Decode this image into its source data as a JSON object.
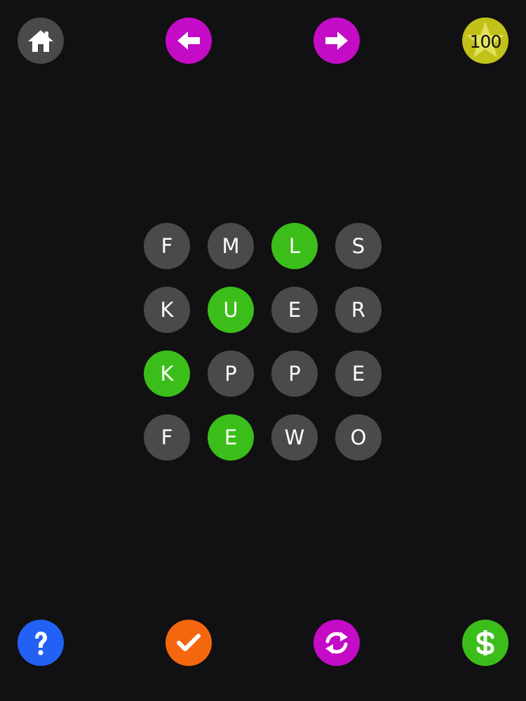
{
  "top_bar": {
    "home": {
      "icon": "home-icon"
    },
    "prev": {
      "icon": "arrow-left-icon"
    },
    "next": {
      "icon": "arrow-right-icon"
    },
    "score": {
      "icon": "star-icon",
      "value": "100"
    }
  },
  "board": {
    "tiles": [
      {
        "letter": "F",
        "selected": false
      },
      {
        "letter": "M",
        "selected": false
      },
      {
        "letter": "L",
        "selected": true
      },
      {
        "letter": "S",
        "selected": false
      },
      {
        "letter": "K",
        "selected": false
      },
      {
        "letter": "U",
        "selected": true
      },
      {
        "letter": "E",
        "selected": false
      },
      {
        "letter": "R",
        "selected": false
      },
      {
        "letter": "K",
        "selected": true
      },
      {
        "letter": "P",
        "selected": false
      },
      {
        "letter": "P",
        "selected": false
      },
      {
        "letter": "E",
        "selected": false
      },
      {
        "letter": "F",
        "selected": false
      },
      {
        "letter": "E",
        "selected": true
      },
      {
        "letter": "W",
        "selected": false
      },
      {
        "letter": "O",
        "selected": false
      }
    ]
  },
  "bottom_bar": {
    "help": {
      "icon": "question-mark-icon"
    },
    "submit": {
      "icon": "checkmark-icon"
    },
    "shuffle": {
      "icon": "shuffle-icon"
    },
    "shop": {
      "icon": "dollar-icon"
    }
  },
  "colors": {
    "background": "#111012",
    "tile": "#4a4a4c",
    "tile_selected": "#3cbe1a",
    "magenta": "#c40bc6",
    "yellow": "#c2c11a",
    "blue": "#2361f5",
    "orange": "#f4670f",
    "green": "#3cbe1a"
  }
}
